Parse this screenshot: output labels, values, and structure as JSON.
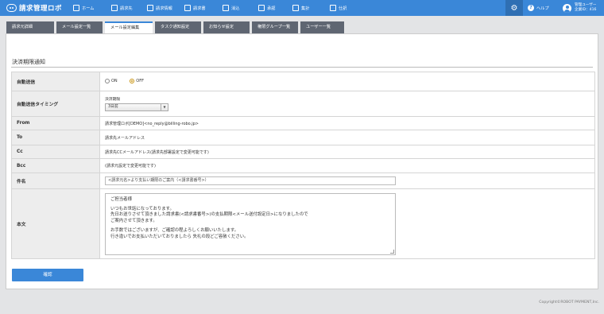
{
  "app": {
    "logo_text": "請求管理ロボ"
  },
  "nav": {
    "items": [
      {
        "label": "ホーム",
        "icon": "home-icon"
      },
      {
        "label": "請求先",
        "icon": "building-icon"
      },
      {
        "label": "請求情報",
        "icon": "link-icon"
      },
      {
        "label": "請求書",
        "icon": "invoice-icon"
      },
      {
        "label": "消込",
        "icon": "download-icon"
      },
      {
        "label": "承認",
        "icon": "check-icon"
      },
      {
        "label": "集計",
        "icon": "calculator-icon"
      },
      {
        "label": "仕訳",
        "icon": "book-icon"
      }
    ],
    "help_label": "ヘルプ",
    "help_glyph": "?",
    "gear_glyph": "⚙",
    "user_name": "管理ユーザー",
    "company_id": "企業ID：416"
  },
  "tabs": [
    {
      "label": "請求元詳細",
      "active": false
    },
    {
      "label": "メール設定一覧",
      "active": false
    },
    {
      "label": "メール設定編集",
      "active": true
    },
    {
      "label": "タスク通知設定",
      "active": false
    },
    {
      "label": "お知らせ設定",
      "active": false
    },
    {
      "label": "権限グループ一覧",
      "active": false
    },
    {
      "label": "ユーザー一覧",
      "active": false
    }
  ],
  "section_title": "決済期限通知",
  "form": {
    "auto_send": {
      "label": "自動送信",
      "options": [
        {
          "label": "ON",
          "checked": false
        },
        {
          "label": "OFF",
          "checked": true
        }
      ]
    },
    "timing": {
      "label": "自動送信タイミング",
      "sublabel": "決済期限",
      "selected": "3日前",
      "arrow_glyph": "▼"
    },
    "from": {
      "label": "From",
      "value": "請求管理ロボ[DEMO]<no_reply@billing-robo.jp>"
    },
    "to": {
      "label": "To",
      "value": "請求先メールアドレス"
    },
    "cc": {
      "label": "Cc",
      "value": "請求先CCメールアドレス(請求先部署設定で変更可能です)"
    },
    "bcc": {
      "label": "Bcc",
      "value": "(請求元設定で変更可能です)"
    },
    "subject": {
      "label": "件名",
      "value": "<請求元名>より支払い期限のご案内（<請求書番号>）"
    },
    "body": {
      "label": "本文",
      "lines": [
        "ご担当者様",
        "",
        "いつもお世話になっております。",
        "先日お送りさせて頂きました請求書(<請求書番号>)の支払期限<メール送付設定日>になりましたので",
        "ご案内させて頂きます。",
        "",
        "お手数ではございますが、ご確認の程よろしくお願いいたします。",
        "行き違いでお支払いただいておりましたら 失礼の段どご容赦ください。"
      ]
    }
  },
  "confirm_label": "確認",
  "footer": "Copyright©ROBOT PAYMENT,Inc.",
  "colors": {
    "accent": "#3a87d8",
    "tab_inactive": "#5f6672",
    "radio_checked": "#c8930e"
  }
}
